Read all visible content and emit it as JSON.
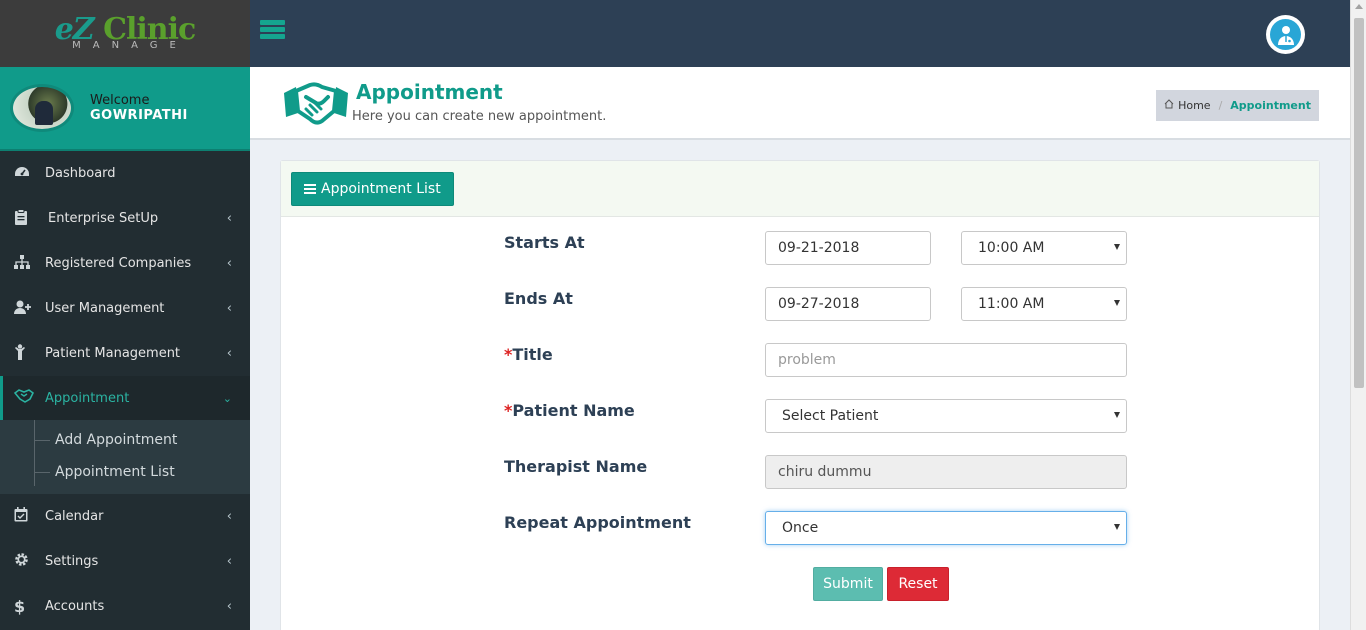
{
  "logo": {
    "ez": "eZ",
    "clinic": "Clinic",
    "sub": "MANAGE"
  },
  "user": {
    "welcome": "Welcome",
    "name": "GOWRIPATHI"
  },
  "sidebar": {
    "items": [
      {
        "label": "Dashboard",
        "icon": "dashboard-icon"
      },
      {
        "label": "Enterprise SetUp",
        "icon": "clipboard-icon"
      },
      {
        "label": "Registered Companies",
        "icon": "sitemap-icon"
      },
      {
        "label": "User Management",
        "icon": "user-plus-icon"
      },
      {
        "label": "Patient Management",
        "icon": "patient-icon"
      },
      {
        "label": "Appointment",
        "icon": "handshake-icon"
      },
      {
        "label": "Calendar",
        "icon": "calendar-icon"
      },
      {
        "label": "Settings",
        "icon": "gear-icon"
      },
      {
        "label": "Accounts",
        "icon": "dollar-icon"
      }
    ],
    "sub_items": [
      "Add Appointment",
      "Appointment List"
    ]
  },
  "header": {
    "title": "Appointment",
    "subtitle": "Here you can create new appointment.",
    "breadcrumb": {
      "home": "Home",
      "current": "Appointment"
    }
  },
  "panel": {
    "list_button": "Appointment List"
  },
  "form": {
    "starts_at": {
      "label": "Starts At",
      "date": "09-21-2018",
      "time": "10:00 AM"
    },
    "ends_at": {
      "label": "Ends At",
      "date": "09-27-2018",
      "time": "11:00 AM"
    },
    "title": {
      "required": "*",
      "label": "Title",
      "placeholder": "problem"
    },
    "patient": {
      "required": "*",
      "label": "Patient Name",
      "value": "Select Patient"
    },
    "therapist": {
      "label": "Therapist Name",
      "value": "chiru dummu"
    },
    "repeat": {
      "label": "Repeat Appointment",
      "value": "Once"
    },
    "submit": "Submit",
    "reset": "Reset"
  },
  "colors": {
    "accent": "#109b8a",
    "topbar": "#2d4055",
    "sidebar": "#222d32",
    "reset": "#dd2a36"
  }
}
